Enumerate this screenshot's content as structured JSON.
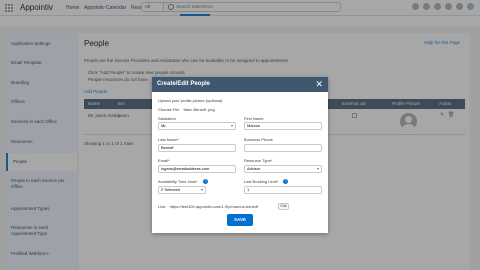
{
  "header": {
    "app_name": "Appointiv",
    "nav": [
      "Home",
      "Appointiv Calendar",
      "Resource Availability",
      "Configure"
    ],
    "active_nav": "Configure",
    "search_scope": "All",
    "search_placeholder": "Search Salesforce"
  },
  "sidebar": {
    "items": [
      "Application Settings",
      "Email Template",
      "Branding",
      "Offices",
      "Services in each Office",
      "Resources",
      "People",
      "People in each Service per Office",
      "Appointment Types",
      "Resources in each Appointment Type",
      "Prefilled Webform+"
    ],
    "active": "People"
  },
  "main": {
    "title": "People",
    "help_link": "Help for this Page",
    "intro": "People are the Service Providers and Assistants who can be bookable or be assigned to appointments",
    "bullets": [
      "Click \"Add People\" to create new people records",
      "People resources do not have"
    ],
    "add_link": "Add People",
    "columns": [
      "Name",
      "Em",
      "External cal",
      "Profile Picture",
      "Action"
    ],
    "rows": [
      {
        "name": "Mr. jason marks",
        "email": "jason"
      }
    ],
    "showing": "Showing 1 to 1 of 1 rows"
  },
  "modal": {
    "title": "Create/Edit People",
    "upload_label": "Upload your profile picture (optional)",
    "choose_file": "Choose File",
    "file_name": "Marc Benioff .png",
    "salutation_label": "Salutation",
    "salutation_value": "Mr.",
    "first_name_label": "First Name",
    "first_name_value": "Marcus",
    "last_name_label": "Last Name*",
    "last_name_value": "Benioff",
    "business_phone_label": "Business Phone",
    "business_phone_value": "",
    "email_label": "Email*",
    "email_value": "logans@emailaddress.com",
    "resource_type_label": "Resource Type*",
    "resource_type_value": "Advisor",
    "availability_label": "Availability Time slots*",
    "availability_value": "2 Selected",
    "last_booking_label": "Last Booking Limit*",
    "last_booking_value": "1",
    "link_label": "Link:",
    "link_value": "https://test100.appointiv.com/1-9/p/marcus-benioff",
    "edit_label": "Edit",
    "save_label": "SAVE"
  },
  "colors": {
    "brand_blue": "#0070d2",
    "header_slate": "#3f5870",
    "sidebar_bg": "#eef4ff"
  }
}
